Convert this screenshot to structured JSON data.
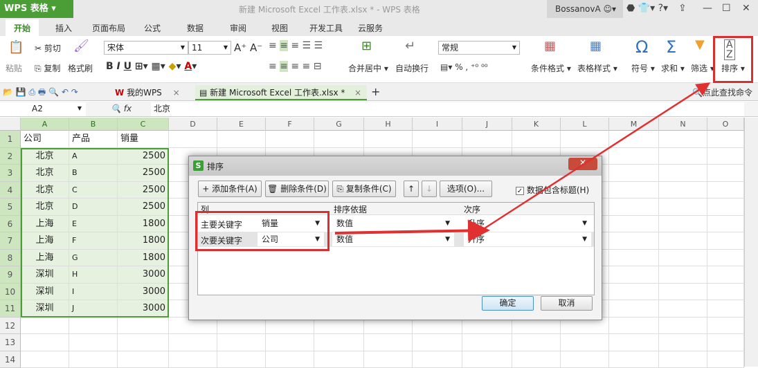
{
  "app": {
    "name": "WPS 表格",
    "window_title": "新建 Microsoft Excel 工作表.xlsx * - WPS 表格",
    "user": "BossanovA"
  },
  "menu_tabs": [
    "开始",
    "插入",
    "页面布局",
    "公式",
    "数据",
    "审阅",
    "视图",
    "开发工具",
    "云服务"
  ],
  "ribbon": {
    "paste": "粘贴",
    "cut": "剪切",
    "copy": "复制",
    "format_painter": "格式刷",
    "font": "宋体",
    "font_size": "11",
    "merge_center": "合并居中",
    "wrap_text": "自动换行",
    "number_format": "常规",
    "percent": "%",
    "conditional_format": "条件格式",
    "table_style": "表格样式",
    "symbol": "符号",
    "sum": "求和",
    "filter": "筛选",
    "sort": "排序",
    "search_command": "点此查找命令"
  },
  "doc_tabs": [
    "我的WPS",
    "新建 Microsoft Excel 工作表.xlsx *"
  ],
  "formula_bar": {
    "cell_ref": "A2",
    "fx": "fx",
    "value": "北京"
  },
  "columns": [
    "A",
    "B",
    "C",
    "D",
    "E",
    "F",
    "G",
    "H",
    "I",
    "J",
    "K",
    "L",
    "M",
    "N",
    "O"
  ],
  "rows": [
    [
      "公司",
      "产品",
      "销量"
    ],
    [
      "北京",
      "A",
      "2500"
    ],
    [
      "北京",
      "B",
      "2500"
    ],
    [
      "北京",
      "C",
      "2500"
    ],
    [
      "北京",
      "D",
      "2500"
    ],
    [
      "上海",
      "E",
      "1800"
    ],
    [
      "上海",
      "F",
      "1800"
    ],
    [
      "上海",
      "G",
      "1800"
    ],
    [
      "深圳",
      "H",
      "3000"
    ],
    [
      "深圳",
      "I",
      "3000"
    ],
    [
      "深圳",
      "J",
      "3000"
    ]
  ],
  "row_numbers": [
    "1",
    "2",
    "3",
    "4",
    "5",
    "6",
    "7",
    "8",
    "9",
    "10",
    "11",
    "12",
    "13",
    "14"
  ],
  "dialog": {
    "title": "排序",
    "add": "添加条件(A)",
    "delete": "删除条件(D)",
    "copy": "复制条件(C)",
    "options": "选项(O)...",
    "has_header": "数据包含标题(H)",
    "has_header_checked": true,
    "headers": [
      "列",
      "排序依据",
      "次序"
    ],
    "conditions": [
      {
        "label": "主要关键字",
        "column": "销量",
        "basis": "数值",
        "order": "升序"
      },
      {
        "label": "次要关键字",
        "column": "公司",
        "basis": "数值",
        "order": "升序"
      }
    ],
    "ok": "确定",
    "cancel": "取消"
  },
  "colors": {
    "brand": "#4a9e35",
    "highlight": "#d83030",
    "selection": "#e6f2df"
  }
}
